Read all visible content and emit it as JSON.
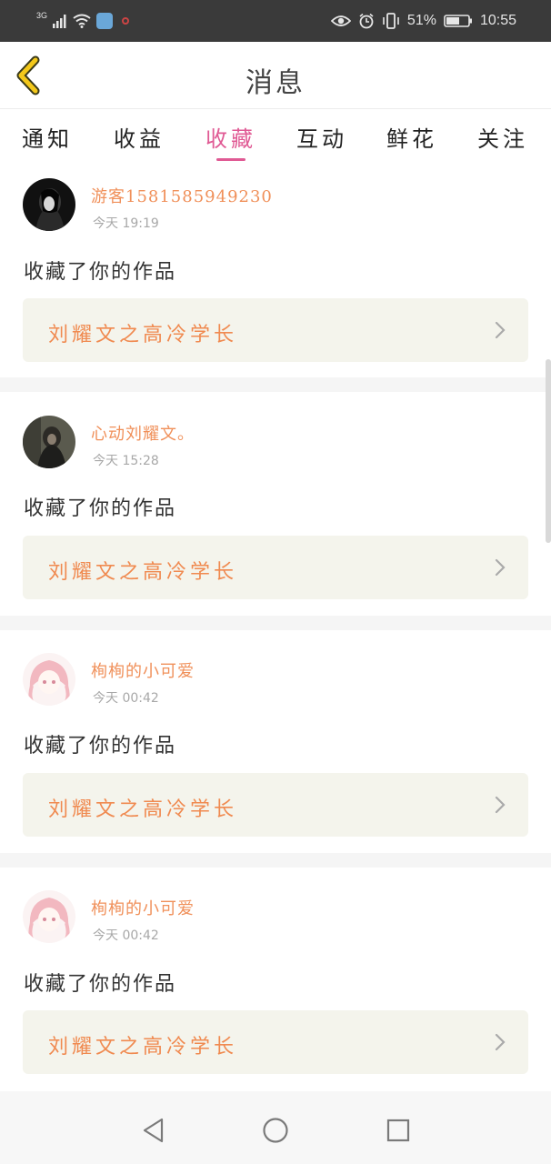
{
  "status_bar": {
    "network": "3G",
    "battery": "51%",
    "time": "10:55"
  },
  "header": {
    "title": "消息",
    "back_icon": "chevron-left-icon",
    "accent_color": "#e05a94"
  },
  "tabs": [
    {
      "label": "通知"
    },
    {
      "label": "收益"
    },
    {
      "label": "收藏"
    },
    {
      "label": "互动"
    },
    {
      "label": "鲜花"
    },
    {
      "label": "关注"
    }
  ],
  "active_tab": "收藏",
  "messages": [
    {
      "user": "游客1581585949230",
      "time": "今天 19:19",
      "action": "收藏了你的作品",
      "work": "刘耀文之高冷学长"
    },
    {
      "user": "心动刘耀文。",
      "time": "今天 15:28",
      "action": "收藏了你的作品",
      "work": "刘耀文之高冷学长"
    },
    {
      "user": "栒栒的小可爱",
      "time": "今天 00:42",
      "action": "收藏了你的作品",
      "work": "刘耀文之高冷学长"
    },
    {
      "user": "栒栒的小可爱",
      "time": "今天 00:42",
      "action": "收藏了你的作品",
      "work": "刘耀文之高冷学长"
    }
  ],
  "nav": {
    "back": "triangle-back-icon",
    "home": "circle-home-icon",
    "recents": "square-recents-icon"
  }
}
